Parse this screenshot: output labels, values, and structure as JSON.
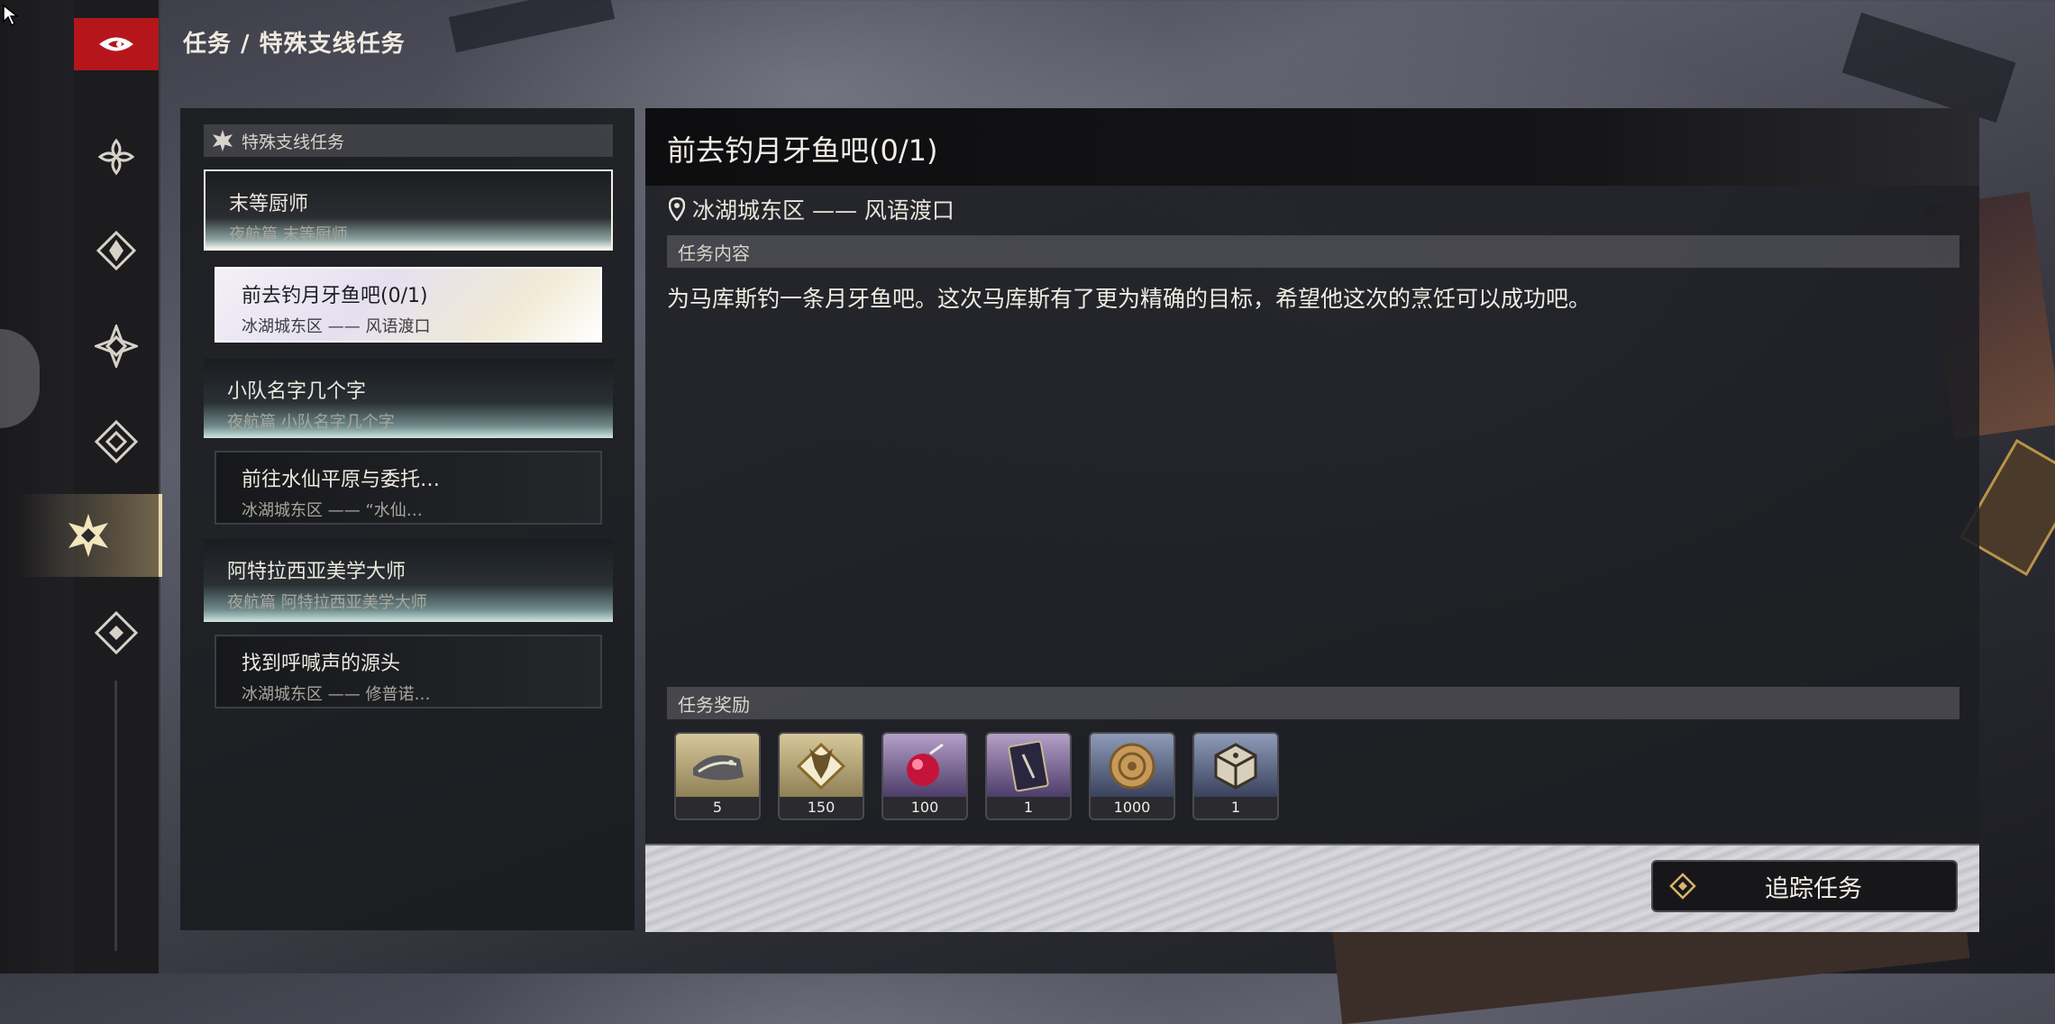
{
  "breadcrumb": "任务 / 特殊支线任务",
  "list": {
    "header": "特殊支线任务",
    "quests": [
      {
        "title": "末等厨师",
        "subtitle": "夜航篇  末等厨师"
      },
      {
        "title": "前去钓月牙鱼吧(0/1)",
        "subtitle": "冰湖城东区 —— 风语渡口"
      },
      {
        "title": "小队名字几个字",
        "subtitle": "夜航篇  小队名字几个字"
      },
      {
        "title": "前往水仙平原与委托…",
        "subtitle": "冰湖城东区 —— “水仙…"
      },
      {
        "title": "阿特拉西亚美学大师",
        "subtitle": "夜航篇  阿特拉西亚美学大师"
      },
      {
        "title": "找到呼喊声的源头",
        "subtitle": "冰湖城东区 —— 修普诺…"
      }
    ]
  },
  "detail": {
    "title": "前去钓月牙鱼吧(0/1)",
    "location": "冰湖城东区 —— 风语渡口",
    "content_header": "任务内容",
    "content": "为马库斯钓一条月牙鱼吧。这次马库斯有了更为精确的目标，希望他这次的烹饪可以成功吧。",
    "rewards_header": "任务奖励",
    "rewards": [
      {
        "qty": "5",
        "icon": "fish-scroll-icon"
      },
      {
        "qty": "150",
        "icon": "gold-crest-icon"
      },
      {
        "qty": "100",
        "icon": "red-orb-icon"
      },
      {
        "qty": "1",
        "icon": "purple-book-icon"
      },
      {
        "qty": "1000",
        "icon": "coin-icon"
      },
      {
        "qty": "1",
        "icon": "dice-icon"
      }
    ],
    "track_button": "追踪任务"
  },
  "nav": [
    "back-logo-icon",
    "petal-icon",
    "fleur-icon",
    "star-diamond-icon",
    "diamond-icon",
    "quest-star-icon",
    "rhombus-icon"
  ],
  "colors": {
    "accent_red": "#b5161b",
    "active_gold": "#e8d9a8"
  }
}
